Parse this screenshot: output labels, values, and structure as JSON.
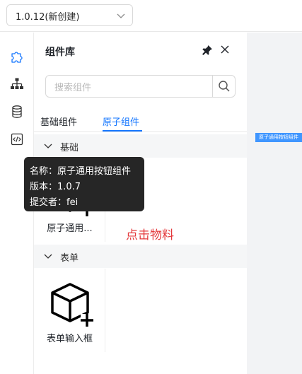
{
  "header": {
    "version_select": {
      "value": "1.0.12(新创建)",
      "icon": "chevron-down-icon"
    }
  },
  "leftbar": {
    "items": [
      {
        "icon": "puzzle-icon",
        "color": "#1677ff"
      },
      {
        "icon": "sitemap-icon",
        "color": "#333333"
      },
      {
        "icon": "database-icon",
        "color": "#333333"
      },
      {
        "icon": "code-file-icon",
        "color": "#333333"
      }
    ]
  },
  "panel": {
    "title": "组件库",
    "pin_icon": "pin-icon",
    "close_icon": "close-icon",
    "search": {
      "placeholder": "搜索组件",
      "button_icon": "search-icon"
    },
    "tabs": [
      {
        "label": "基础组件",
        "active": false
      },
      {
        "label": "原子组件",
        "active": true
      }
    ],
    "groups": [
      {
        "label": "基础",
        "items": [
          {
            "name": "原子通用..."
          }
        ]
      },
      {
        "label": "表单",
        "items": [
          {
            "name": "表单输入框"
          }
        ]
      }
    ]
  },
  "tooltip": {
    "name_line": "名称：原子通用按钮组件",
    "version_line": "版本：1.0.7",
    "author_line": "提交者：fei"
  },
  "hint_text": "点击物料",
  "canvas": {
    "dropped_label": "原子通用按钮组件"
  },
  "colors": {
    "accent": "#1677ff",
    "hint": "#e4393c",
    "tooltip_bg": "#262626",
    "canvas_bg": "#f2f3f5"
  }
}
